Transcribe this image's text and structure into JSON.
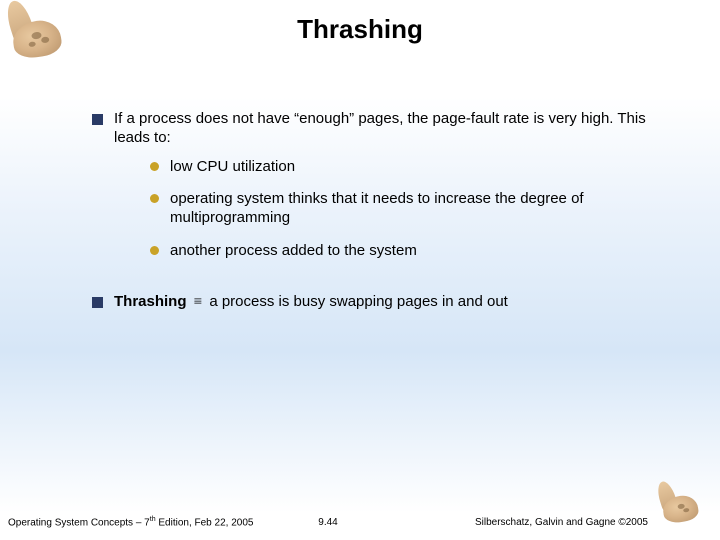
{
  "title": "Thrashing",
  "bullets": {
    "b1": "If a process does not have “enough” pages, the page-fault rate is very high.  This leads to:",
    "sub1": "low CPU utilization",
    "sub2": "operating system thinks that it needs to increase the degree of multiprogramming",
    "sub3": "another process added to the system",
    "b2_strong": "Thrashing",
    "b2_equiv": "≡",
    "b2_rest": " a process is busy swapping pages in and out"
  },
  "footer": {
    "left_a": "Operating System Concepts – 7",
    "left_sup": "th",
    "left_b": " Edition, Feb 22, 2005",
    "center": "9.44",
    "right": "Silberschatz, Galvin and Gagne ©2005"
  },
  "logo_name": "dinosaur-mascot"
}
